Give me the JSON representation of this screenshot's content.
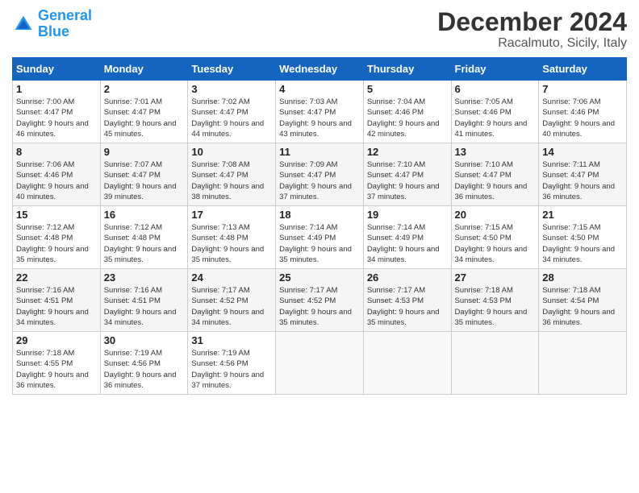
{
  "header": {
    "logo_line1": "General",
    "logo_line2": "Blue",
    "month": "December 2024",
    "location": "Racalmuto, Sicily, Italy"
  },
  "days_of_week": [
    "Sunday",
    "Monday",
    "Tuesday",
    "Wednesday",
    "Thursday",
    "Friday",
    "Saturday"
  ],
  "weeks": [
    [
      {
        "day": "1",
        "sunrise": "7:00 AM",
        "sunset": "4:47 PM",
        "daylight": "9 hours and 46 minutes."
      },
      {
        "day": "2",
        "sunrise": "7:01 AM",
        "sunset": "4:47 PM",
        "daylight": "9 hours and 45 minutes."
      },
      {
        "day": "3",
        "sunrise": "7:02 AM",
        "sunset": "4:47 PM",
        "daylight": "9 hours and 44 minutes."
      },
      {
        "day": "4",
        "sunrise": "7:03 AM",
        "sunset": "4:47 PM",
        "daylight": "9 hours and 43 minutes."
      },
      {
        "day": "5",
        "sunrise": "7:04 AM",
        "sunset": "4:46 PM",
        "daylight": "9 hours and 42 minutes."
      },
      {
        "day": "6",
        "sunrise": "7:05 AM",
        "sunset": "4:46 PM",
        "daylight": "9 hours and 41 minutes."
      },
      {
        "day": "7",
        "sunrise": "7:06 AM",
        "sunset": "4:46 PM",
        "daylight": "9 hours and 40 minutes."
      }
    ],
    [
      {
        "day": "8",
        "sunrise": "7:06 AM",
        "sunset": "4:46 PM",
        "daylight": "9 hours and 40 minutes."
      },
      {
        "day": "9",
        "sunrise": "7:07 AM",
        "sunset": "4:47 PM",
        "daylight": "9 hours and 39 minutes."
      },
      {
        "day": "10",
        "sunrise": "7:08 AM",
        "sunset": "4:47 PM",
        "daylight": "9 hours and 38 minutes."
      },
      {
        "day": "11",
        "sunrise": "7:09 AM",
        "sunset": "4:47 PM",
        "daylight": "9 hours and 37 minutes."
      },
      {
        "day": "12",
        "sunrise": "7:10 AM",
        "sunset": "4:47 PM",
        "daylight": "9 hours and 37 minutes."
      },
      {
        "day": "13",
        "sunrise": "7:10 AM",
        "sunset": "4:47 PM",
        "daylight": "9 hours and 36 minutes."
      },
      {
        "day": "14",
        "sunrise": "7:11 AM",
        "sunset": "4:47 PM",
        "daylight": "9 hours and 36 minutes."
      }
    ],
    [
      {
        "day": "15",
        "sunrise": "7:12 AM",
        "sunset": "4:48 PM",
        "daylight": "9 hours and 35 minutes."
      },
      {
        "day": "16",
        "sunrise": "7:12 AM",
        "sunset": "4:48 PM",
        "daylight": "9 hours and 35 minutes."
      },
      {
        "day": "17",
        "sunrise": "7:13 AM",
        "sunset": "4:48 PM",
        "daylight": "9 hours and 35 minutes."
      },
      {
        "day": "18",
        "sunrise": "7:14 AM",
        "sunset": "4:49 PM",
        "daylight": "9 hours and 35 minutes."
      },
      {
        "day": "19",
        "sunrise": "7:14 AM",
        "sunset": "4:49 PM",
        "daylight": "9 hours and 34 minutes."
      },
      {
        "day": "20",
        "sunrise": "7:15 AM",
        "sunset": "4:50 PM",
        "daylight": "9 hours and 34 minutes."
      },
      {
        "day": "21",
        "sunrise": "7:15 AM",
        "sunset": "4:50 PM",
        "daylight": "9 hours and 34 minutes."
      }
    ],
    [
      {
        "day": "22",
        "sunrise": "7:16 AM",
        "sunset": "4:51 PM",
        "daylight": "9 hours and 34 minutes."
      },
      {
        "day": "23",
        "sunrise": "7:16 AM",
        "sunset": "4:51 PM",
        "daylight": "9 hours and 34 minutes."
      },
      {
        "day": "24",
        "sunrise": "7:17 AM",
        "sunset": "4:52 PM",
        "daylight": "9 hours and 34 minutes."
      },
      {
        "day": "25",
        "sunrise": "7:17 AM",
        "sunset": "4:52 PM",
        "daylight": "9 hours and 35 minutes."
      },
      {
        "day": "26",
        "sunrise": "7:17 AM",
        "sunset": "4:53 PM",
        "daylight": "9 hours and 35 minutes."
      },
      {
        "day": "27",
        "sunrise": "7:18 AM",
        "sunset": "4:53 PM",
        "daylight": "9 hours and 35 minutes."
      },
      {
        "day": "28",
        "sunrise": "7:18 AM",
        "sunset": "4:54 PM",
        "daylight": "9 hours and 36 minutes."
      }
    ],
    [
      {
        "day": "29",
        "sunrise": "7:18 AM",
        "sunset": "4:55 PM",
        "daylight": "9 hours and 36 minutes."
      },
      {
        "day": "30",
        "sunrise": "7:19 AM",
        "sunset": "4:56 PM",
        "daylight": "9 hours and 36 minutes."
      },
      {
        "day": "31",
        "sunrise": "7:19 AM",
        "sunset": "4:56 PM",
        "daylight": "9 hours and 37 minutes."
      },
      null,
      null,
      null,
      null
    ]
  ]
}
